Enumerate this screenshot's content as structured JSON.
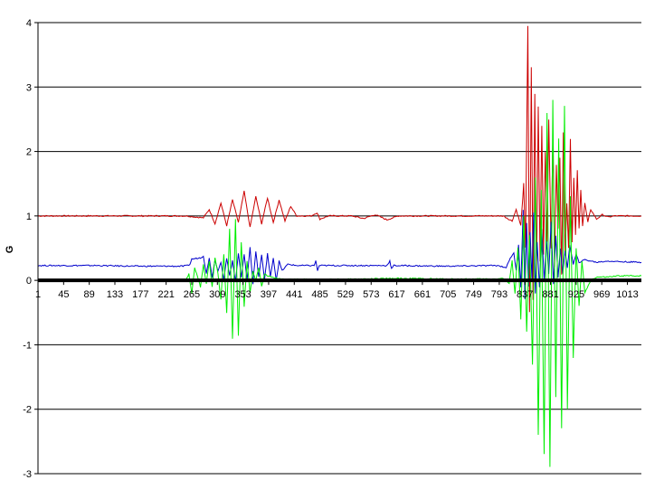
{
  "chart_data": {
    "type": "line",
    "title": "",
    "xlabel": "",
    "ylabel": "G",
    "xlim": [
      1,
      1037
    ],
    "ylim": [
      -3,
      4
    ],
    "y_ticks": [
      -3,
      -2,
      -1,
      0,
      1,
      2,
      3,
      4
    ],
    "x_ticks": [
      1,
      45,
      89,
      133,
      177,
      221,
      265,
      309,
      353,
      397,
      441,
      485,
      529,
      573,
      617,
      661,
      705,
      749,
      793,
      837,
      881,
      925,
      969,
      1013
    ],
    "grid": "horizontal",
    "legend": "none",
    "series": [
      {
        "color": "#cc0000",
        "baseline": 1.0,
        "points": [
          [
            1,
            1.0
          ],
          [
            255,
            1.0
          ],
          [
            285,
            0.97
          ],
          [
            295,
            1.1
          ],
          [
            305,
            0.88
          ],
          [
            315,
            1.2
          ],
          [
            325,
            0.85
          ],
          [
            335,
            1.25
          ],
          [
            345,
            0.9
          ],
          [
            355,
            1.38
          ],
          [
            365,
            0.82
          ],
          [
            375,
            1.3
          ],
          [
            385,
            0.88
          ],
          [
            395,
            1.28
          ],
          [
            405,
            0.9
          ],
          [
            415,
            1.25
          ],
          [
            425,
            0.92
          ],
          [
            435,
            1.15
          ],
          [
            445,
            1.0
          ],
          [
            470,
            1.0
          ],
          [
            480,
            1.05
          ],
          [
            485,
            0.95
          ],
          [
            500,
            1.0
          ],
          [
            540,
            1.0
          ],
          [
            560,
            0.96
          ],
          [
            580,
            1.02
          ],
          [
            600,
            0.94
          ],
          [
            620,
            1.0
          ],
          [
            700,
            1.0
          ],
          [
            800,
            1.0
          ],
          [
            815,
            0.92
          ],
          [
            822,
            1.1
          ],
          [
            830,
            0.85
          ],
          [
            835,
            1.5
          ],
          [
            838,
            0.5
          ],
          [
            842,
            3.95
          ],
          [
            845,
            -0.5
          ],
          [
            848,
            3.3
          ],
          [
            851,
            -0.3
          ],
          [
            854,
            2.9
          ],
          [
            857,
            0.1
          ],
          [
            860,
            2.7
          ],
          [
            863,
            0.3
          ],
          [
            866,
            2.4
          ],
          [
            869,
            0.4
          ],
          [
            872,
            2.0
          ],
          [
            875,
            0.6
          ],
          [
            878,
            2.5
          ],
          [
            882,
            0.5
          ],
          [
            885,
            2.2
          ],
          [
            888,
            0.2
          ],
          [
            891,
            1.8
          ],
          [
            894,
            0.8
          ],
          [
            897,
            1.9
          ],
          [
            900,
            0.1
          ],
          [
            903,
            2.3
          ],
          [
            906,
            0.4
          ],
          [
            909,
            1.2
          ],
          [
            912,
            0.5
          ],
          [
            915,
            2.2
          ],
          [
            918,
            0.6
          ],
          [
            921,
            1.6
          ],
          [
            924,
            0.7
          ],
          [
            927,
            1.7
          ],
          [
            930,
            0.8
          ],
          [
            933,
            1.4
          ],
          [
            936,
            0.85
          ],
          [
            940,
            1.2
          ],
          [
            945,
            0.9
          ],
          [
            950,
            1.1
          ],
          [
            960,
            0.95
          ],
          [
            970,
            1.02
          ],
          [
            980,
            0.98
          ],
          [
            990,
            1.0
          ],
          [
            1037,
            1.0
          ]
        ]
      },
      {
        "color": "#0000cc",
        "baseline": 0.23,
        "points": [
          [
            1,
            0.23
          ],
          [
            100,
            0.23
          ],
          [
            170,
            0.22
          ],
          [
            250,
            0.22
          ],
          [
            258,
            0.23
          ],
          [
            262,
            0.25
          ],
          [
            265,
            0.33
          ],
          [
            280,
            0.35
          ],
          [
            285,
            0.38
          ],
          [
            290,
            0.1
          ],
          [
            295,
            0.35
          ],
          [
            300,
            0.05
          ],
          [
            305,
            0.32
          ],
          [
            310,
            0.15
          ],
          [
            315,
            0.28
          ],
          [
            320,
            0.0
          ],
          [
            325,
            0.35
          ],
          [
            330,
            0.08
          ],
          [
            335,
            0.3
          ],
          [
            340,
            -0.02
          ],
          [
            345,
            0.42
          ],
          [
            350,
            0.05
          ],
          [
            355,
            0.4
          ],
          [
            360,
            0.0
          ],
          [
            365,
            0.52
          ],
          [
            370,
            -0.05
          ],
          [
            375,
            0.45
          ],
          [
            380,
            0.05
          ],
          [
            385,
            0.4
          ],
          [
            390,
            0.0
          ],
          [
            395,
            0.42
          ],
          [
            400,
            0.05
          ],
          [
            405,
            0.35
          ],
          [
            410,
            0.0
          ],
          [
            415,
            0.3
          ],
          [
            420,
            0.15
          ],
          [
            430,
            0.25
          ],
          [
            445,
            0.23
          ],
          [
            475,
            0.23
          ],
          [
            478,
            0.3
          ],
          [
            481,
            0.15
          ],
          [
            484,
            0.23
          ],
          [
            600,
            0.23
          ],
          [
            605,
            0.3
          ],
          [
            608,
            0.18
          ],
          [
            612,
            0.23
          ],
          [
            700,
            0.22
          ],
          [
            790,
            0.23
          ],
          [
            805,
            0.2
          ],
          [
            812,
            0.35
          ],
          [
            818,
            0.42
          ],
          [
            822,
            0.15
          ],
          [
            826,
            0.55
          ],
          [
            830,
            -0.1
          ],
          [
            834,
            1.1
          ],
          [
            837,
            -0.3
          ],
          [
            840,
            0.9
          ],
          [
            843,
            -0.1
          ],
          [
            846,
            0.75
          ],
          [
            849,
            0.0
          ],
          [
            852,
            1.05
          ],
          [
            855,
            -0.2
          ],
          [
            858,
            0.6
          ],
          [
            862,
            -0.1
          ],
          [
            866,
            0.8
          ],
          [
            870,
            0.0
          ],
          [
            874,
            0.6
          ],
          [
            878,
            0.1
          ],
          [
            882,
            0.9
          ],
          [
            886,
            -0.05
          ],
          [
            890,
            0.7
          ],
          [
            894,
            0.05
          ],
          [
            898,
            0.5
          ],
          [
            902,
            0.1
          ],
          [
            906,
            0.45
          ],
          [
            910,
            0.2
          ],
          [
            914,
            0.55
          ],
          [
            920,
            0.25
          ],
          [
            925,
            0.4
          ],
          [
            930,
            0.28
          ],
          [
            940,
            0.32
          ],
          [
            960,
            0.28
          ],
          [
            980,
            0.3
          ],
          [
            1000,
            0.29
          ],
          [
            1037,
            0.28
          ]
        ]
      },
      {
        "color": "#00ee00",
        "baseline": 0.0,
        "points": [
          [
            1,
            0.0
          ],
          [
            240,
            0.0
          ],
          [
            255,
            0.0
          ],
          [
            260,
            0.1
          ],
          [
            265,
            -0.2
          ],
          [
            270,
            0.2
          ],
          [
            275,
            0.05
          ],
          [
            280,
            -0.1
          ],
          [
            285,
            0.25
          ],
          [
            290,
            -0.05
          ],
          [
            295,
            0.3
          ],
          [
            300,
            -0.1
          ],
          [
            305,
            0.35
          ],
          [
            310,
            0.1
          ],
          [
            315,
            -0.3
          ],
          [
            320,
            0.4
          ],
          [
            325,
            -0.5
          ],
          [
            330,
            0.8
          ],
          [
            335,
            -0.9
          ],
          [
            340,
            0.95
          ],
          [
            345,
            -0.85
          ],
          [
            350,
            0.6
          ],
          [
            355,
            -0.4
          ],
          [
            360,
            0.3
          ],
          [
            365,
            -0.2
          ],
          [
            370,
            0.15
          ],
          [
            375,
            0.0
          ],
          [
            380,
            0.2
          ],
          [
            385,
            -0.1
          ],
          [
            390,
            0.1
          ],
          [
            400,
            0.05
          ],
          [
            420,
            0.02
          ],
          [
            480,
            0.01
          ],
          [
            560,
            0.02
          ],
          [
            620,
            0.03
          ],
          [
            700,
            0.02
          ],
          [
            780,
            0.02
          ],
          [
            800,
            0.03
          ],
          [
            810,
            -0.05
          ],
          [
            815,
            0.3
          ],
          [
            820,
            -0.2
          ],
          [
            825,
            0.5
          ],
          [
            830,
            -0.6
          ],
          [
            835,
            1.0
          ],
          [
            840,
            -0.8
          ],
          [
            845,
            0.7
          ],
          [
            850,
            -1.3
          ],
          [
            855,
            1.6
          ],
          [
            860,
            -2.4
          ],
          [
            865,
            1.4
          ],
          [
            870,
            -2.7
          ],
          [
            875,
            2.6
          ],
          [
            880,
            -2.9
          ],
          [
            885,
            2.8
          ],
          [
            890,
            -1.8
          ],
          [
            895,
            2.2
          ],
          [
            900,
            -2.3
          ],
          [
            905,
            2.7
          ],
          [
            910,
            -2.0
          ],
          [
            915,
            1.3
          ],
          [
            920,
            -1.2
          ],
          [
            925,
            0.5
          ],
          [
            930,
            -0.4
          ],
          [
            935,
            0.3
          ],
          [
            940,
            -0.2
          ],
          [
            950,
            0.0
          ],
          [
            960,
            0.05
          ],
          [
            980,
            0.05
          ],
          [
            1000,
            0.07
          ],
          [
            1037,
            0.07
          ]
        ]
      }
    ]
  }
}
